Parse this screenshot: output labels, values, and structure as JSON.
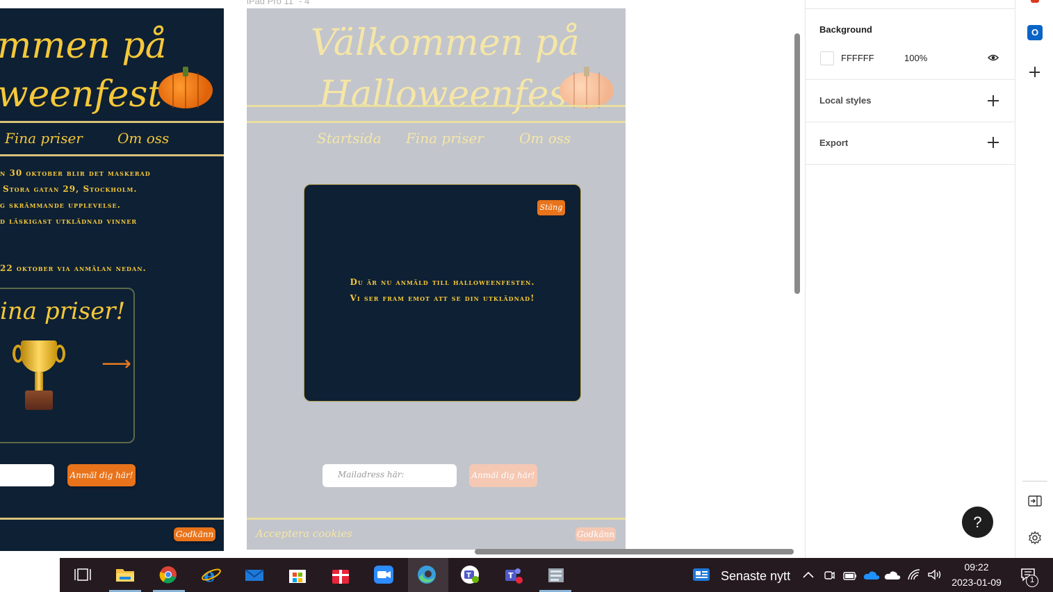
{
  "canvas": {
    "frame1": {
      "title_line1": "mmen på",
      "title_line2": "weenfest",
      "nav": [
        "Fina priser",
        "Om oss"
      ],
      "info_lines": [
        "n 30 oktober blir det maskerad",
        "Stora gatan 29, Stockholm.",
        "g skrämmande upplevelse.",
        "d läskigast utklädnad vinner",
        "22 oktober via anmälan nedan."
      ],
      "prize_title": "ina priser!",
      "arrow": "⟶",
      "signup_button": "Anmäl dig här!",
      "cookie_button": "Godkänn"
    },
    "frame2": {
      "label": "iPad Pro 11\" - 4",
      "title_line1": "Välkommen på",
      "title_line2": "Halloweenfest",
      "nav": [
        "Startsida",
        "Fina priser",
        "Om oss"
      ],
      "modal": {
        "close_label": "Stäng",
        "message_line1": "Du är nu anmäld till halloweenfesten.",
        "message_line2": "Vi ser fram emot att se din utklädnad!"
      },
      "email_placeholder": "Mailadress här:",
      "signup_button": "Anmäl dig här!",
      "cookie_text": "Acceptera cookies",
      "cookie_button": "Godkänn"
    }
  },
  "panel": {
    "background_heading": "Background",
    "background_hex": "FFFFFF",
    "background_opacity": "100%",
    "local_styles_heading": "Local styles",
    "export_heading": "Export",
    "help_label": "?"
  },
  "strip": {
    "outlook_letter": "O"
  },
  "taskbar": {
    "news_label": "Senaste nytt",
    "time": "09:22",
    "date": "2023-01-09",
    "notification_count": "1",
    "apps": [
      "task-view",
      "file-explorer",
      "chrome",
      "internet-explorer",
      "mail",
      "microsoft-store",
      "gift",
      "zoom",
      "edge",
      "teams",
      "teams-alt",
      "files"
    ]
  },
  "colors": {
    "dark_navy": "#0e2033",
    "gold": "#f5c83a",
    "orange": "#e8731a",
    "ipad_bg": "#c2c5cb",
    "taskbar": "#251a1f"
  }
}
